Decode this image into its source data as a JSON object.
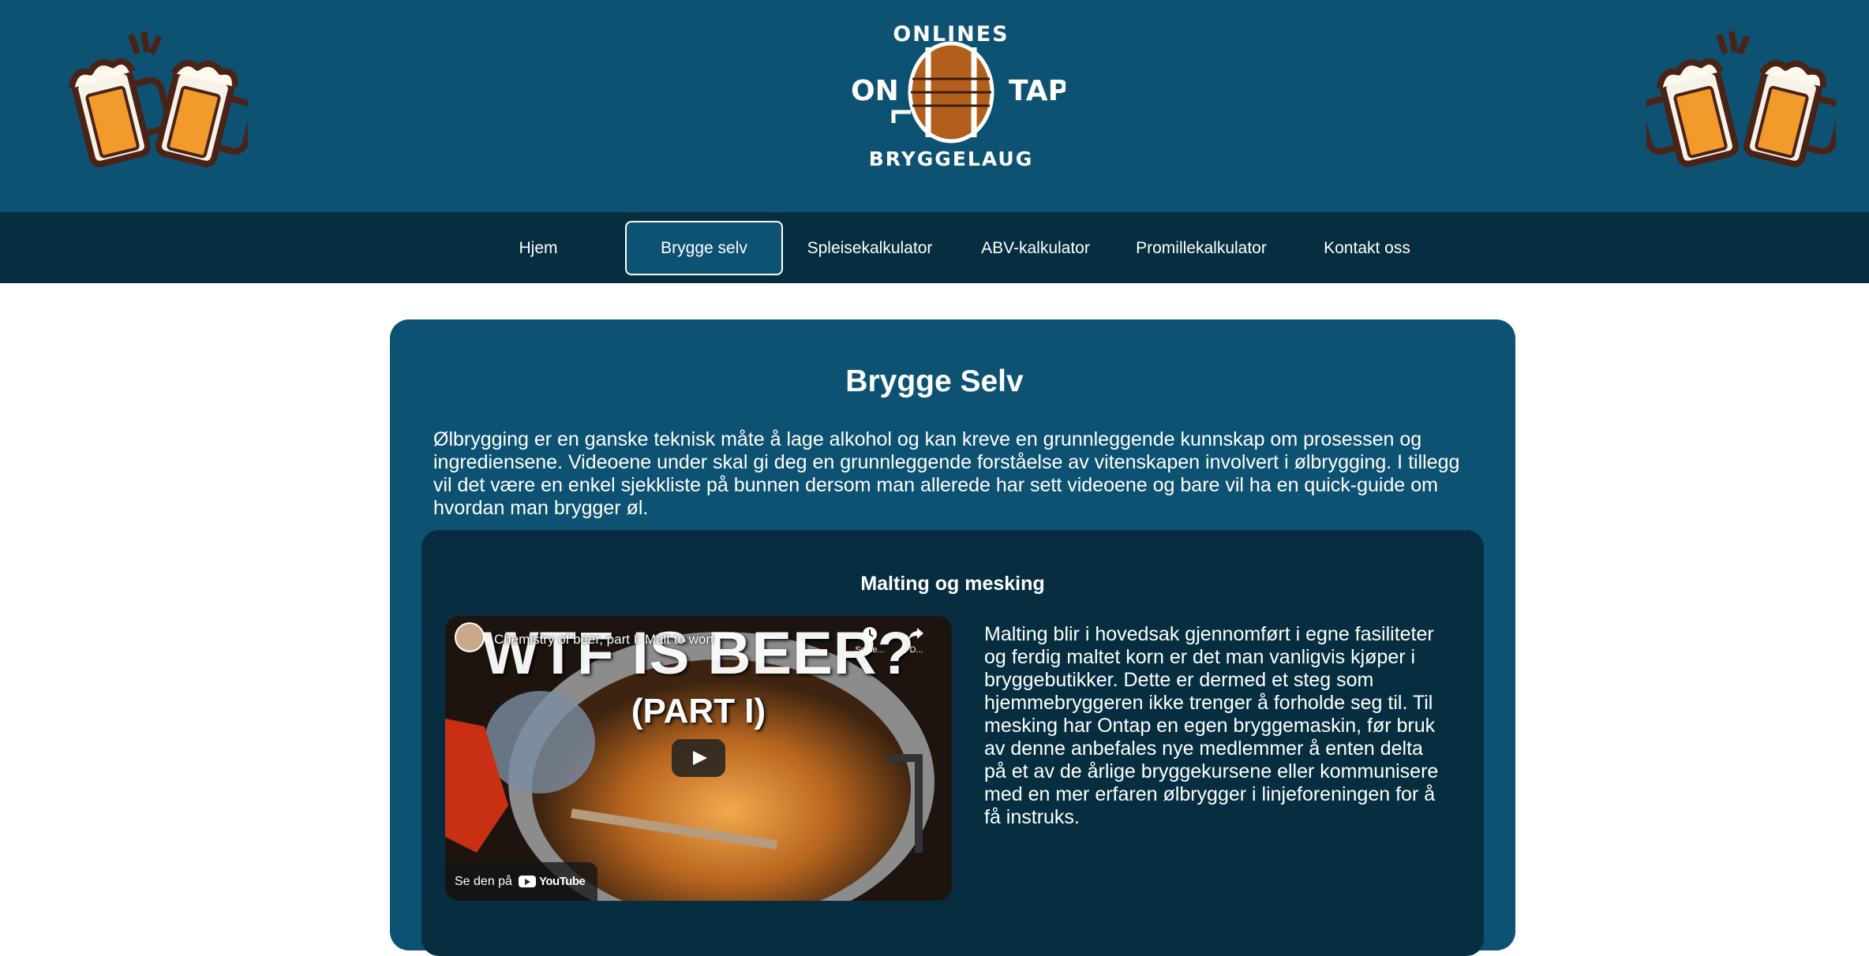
{
  "logo": {
    "top_text": "ONLINES",
    "left_text": "ON",
    "right_text": "TAP",
    "bottom_text": "BRYGGELAUG"
  },
  "nav": {
    "items": [
      {
        "label": "Hjem"
      },
      {
        "label": "Brygge selv",
        "active": true
      },
      {
        "label": "Spleisekalkulator"
      },
      {
        "label": "ABV-kalkulator"
      },
      {
        "label": "Promillekalkulator"
      },
      {
        "label": "Kontakt oss"
      }
    ]
  },
  "page": {
    "title": "Brygge Selv",
    "intro": "Ølbrygging er en ganske teknisk måte å lage alkohol og kan kreve en grunnleggende kunnskap om prosessen og ingrediensene. Videoene under skal gi deg en grunnleggende forståelse av vitenskapen involvert i ølbrygging. I tillegg vil det være en enkel sjekkliste på bunnen dersom man allerede har sett videoene og bare vil ha en quick-guide om hvordan man brygger øl."
  },
  "section": {
    "title": "Malting og mesking",
    "text": "Malting blir i hovedsak gjennomført i egne fasiliteter og ferdig maltet korn er det man vanligvis kjøper i bryggebutikker. Dette er dermed et steg som hjemmebryggeren ikke trenger å forholde seg til. Til mesking har Ontap en egen bryggemaskin, før bruk av denne anbefales nye medlemmer å enten delta på et av de årlige bryggekursene eller kommunisere med en mer erfaren ølbrygger i linjeforeningen for å få instruks.",
    "video": {
      "title": "Chemistry of beer, part I: Malt to wort",
      "big_title": "WTF IS BEER?",
      "sub_title": "(PART I)",
      "watch_later": "Se se...",
      "share": "D...",
      "watch_on": "Se den på",
      "brand": "YouTube"
    }
  },
  "colors": {
    "header": "#0d5272",
    "nav": "#062e40",
    "card": "#0d5272",
    "section": "#062e40"
  }
}
